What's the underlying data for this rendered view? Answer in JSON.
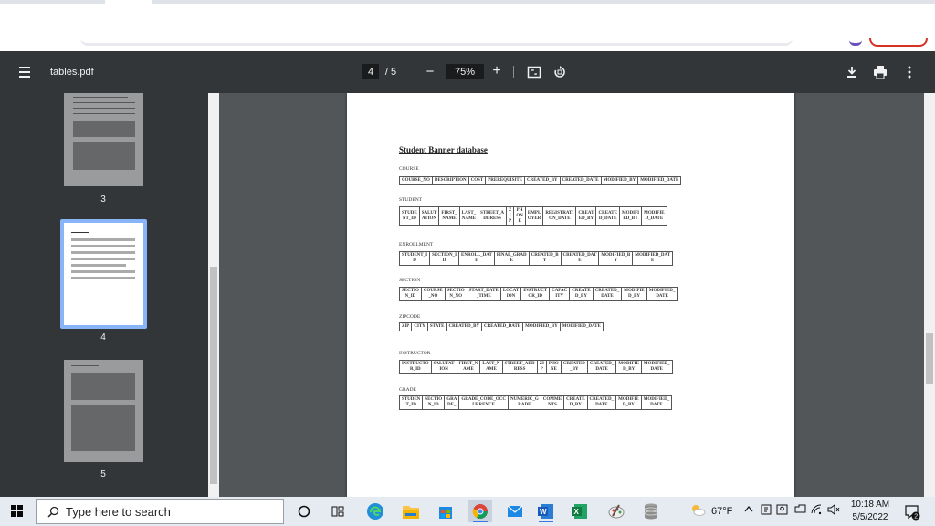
{
  "toolbar": {
    "file_title": "tables.pdf",
    "current_page": "4",
    "page_separator": "/ 5",
    "zoom_level": "75%",
    "zoom_out_label": "−",
    "zoom_in_label": "+"
  },
  "sidebar": {
    "thumbnails": [
      {
        "page_label": "3"
      },
      {
        "page_label": "4"
      },
      {
        "page_label": "5"
      }
    ]
  },
  "document": {
    "title": "Student Banner database",
    "tables": [
      {
        "name": "COURSE",
        "columns": [
          "COURSE_NO",
          "DESCRIPTION",
          "COST",
          "PREREQUISITE",
          "CREATED_BY",
          "CREATED_DATE",
          "MODIFIED_BY",
          "MODIFIED_DATE"
        ]
      },
      {
        "name": "STUDENT",
        "columns": [
          "STUDE\nNT_ID",
          "SALUT\nATION",
          "FIRST_\nNAME",
          "LAST_\nNAME",
          "STREET_A\nDDRESS",
          "Z\nI\nP",
          "PH\nON\nE",
          "EMPL\nOYER",
          "REGISTRATI\nON_DATE",
          "CREAT\nED_BY",
          "CREATE\nD_DATE",
          "MODIFI\nED_BY",
          "MODIFIE\nD_DATE"
        ]
      },
      {
        "name": "ENROLLMENT",
        "columns": [
          "STUDENT_I\nD",
          "SECTION_I\nD",
          "ENROLL_DAT\nE",
          "FINAL_GRAD\nE",
          "CREATED_B\nY",
          "CREATED_DAT\nE",
          "MODIFIED_B\nY",
          "MODIFIED_DAT\nE"
        ]
      },
      {
        "name": "SECTION",
        "columns": [
          "SECTIO\nN_ID",
          "COURSE\n_NO",
          "SECTIO\nN_NO",
          "START_DATE\n_TIME",
          "LOCAT\nION",
          "INSTRUCT\nOR_ID",
          "CAPAC\nITY",
          "CREATE\nD_BY",
          "CREATED_\nDATE",
          "MODIFIE\nD_BY",
          "MODIFIED_\nDATE"
        ]
      },
      {
        "name": "ZIPCODE",
        "columns": [
          "ZIP",
          "CITY",
          "STATE",
          "CREATED_BY",
          "CREATED_DATE",
          "MODIFIED_BY",
          "MODIFIED_DATE"
        ]
      },
      {
        "name": "INSTRUCTOR",
        "columns": [
          "INSTRUCTO\nR_ID",
          "SALUTAT\nION",
          "FIRST_N\nAME",
          "LAST_N\nAME",
          "STREET_ADD\nRESS",
          "ZI\nP",
          "PHO\nNE",
          "CREATED\n_BY",
          "CREATED_\nDATE",
          "MODIFIE\nD_BY",
          "MODIFIED_\nDATE"
        ]
      },
      {
        "name": "GRADE",
        "columns": [
          "STUDEN\nT_ID",
          "SECTIO\nN_ID",
          "GRA\nDE_",
          "GRADE_CODE_OCC\nURRENCE",
          "NUMERIC_G\nRADE",
          "COMME\nNTS",
          "CREATE\nD_BY",
          "CREATED_\nDATE",
          "MODIFIE\nD_BY",
          "MODIFIED_\nDATE"
        ]
      }
    ]
  },
  "taskbar": {
    "search_placeholder": "Type here to search",
    "weather": "67°F",
    "time": "10:18 AM",
    "date": "5/5/2022",
    "notification_count": "2"
  },
  "colors": {
    "toolbar_bg": "#323639",
    "viewer_bg": "#525659",
    "thumb_active_border": "#8ab4f8"
  }
}
